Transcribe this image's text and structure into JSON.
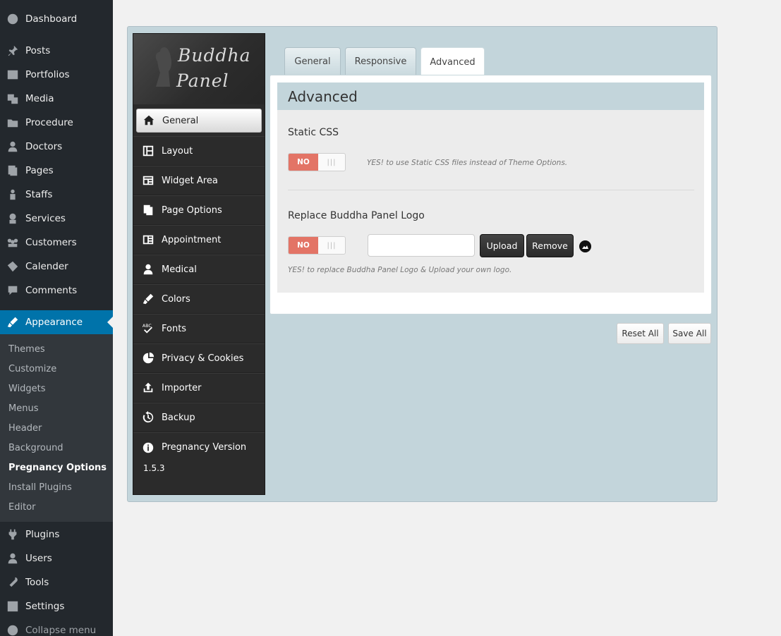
{
  "admin_menu": {
    "items": [
      {
        "label": "Dashboard",
        "icon": "dashboard-icon"
      },
      {
        "label": "Posts",
        "icon": "pin-icon"
      },
      {
        "label": "Portfolios",
        "icon": "portfolio-icon"
      },
      {
        "label": "Media",
        "icon": "media-icon"
      },
      {
        "label": "Procedure",
        "icon": "folder-icon"
      },
      {
        "label": "Doctors",
        "icon": "user-icon"
      },
      {
        "label": "Pages",
        "icon": "pages-icon"
      },
      {
        "label": "Staffs",
        "icon": "staff-icon"
      },
      {
        "label": "Services",
        "icon": "services-icon"
      },
      {
        "label": "Customers",
        "icon": "groups-icon"
      },
      {
        "label": "Calender",
        "icon": "tickets-icon"
      },
      {
        "label": "Comments",
        "icon": "comment-icon"
      },
      {
        "label": "Appearance",
        "icon": "brush-icon"
      },
      {
        "label": "Plugins",
        "icon": "plugin-icon"
      },
      {
        "label": "Users",
        "icon": "users-icon"
      },
      {
        "label": "Tools",
        "icon": "wrench-icon"
      },
      {
        "label": "Settings",
        "icon": "settings-icon"
      },
      {
        "label": "Collapse menu",
        "icon": "collapse-icon"
      }
    ],
    "submenu": [
      "Themes",
      "Customize",
      "Widgets",
      "Menus",
      "Header",
      "Background",
      "Pregnancy Options",
      "Install Plugins",
      "Editor"
    ]
  },
  "panel": {
    "logo_line1": "Buddha",
    "logo_line2": "Panel",
    "nav": [
      {
        "label": "General",
        "icon": "home-icon"
      },
      {
        "label": "Layout",
        "icon": "layout-icon"
      },
      {
        "label": "Widget Area",
        "icon": "widget-icon"
      },
      {
        "label": "Page Options",
        "icon": "page-options-icon"
      },
      {
        "label": "Appointment",
        "icon": "appointment-icon"
      },
      {
        "label": "Medical",
        "icon": "medical-icon"
      },
      {
        "label": "Colors",
        "icon": "brush-icon"
      },
      {
        "label": "Fonts",
        "icon": "fonts-icon"
      },
      {
        "label": "Privacy & Cookies",
        "icon": "pie-icon"
      },
      {
        "label": "Importer",
        "icon": "upload-icon"
      },
      {
        "label": "Backup",
        "icon": "backup-icon"
      },
      {
        "label": "Pregnancy Version",
        "icon": "info-icon"
      }
    ],
    "version": "1.5.3",
    "tabs": [
      "General",
      "Responsive",
      "Advanced"
    ],
    "section_title": "Advanced",
    "static_css": {
      "title": "Static CSS",
      "switch_label": "NO",
      "switch_grip": "|||",
      "hint": "YES! to use Static CSS files instead of Theme Options."
    },
    "replace_logo": {
      "title": "Replace Buddha Panel Logo",
      "switch_label": "NO",
      "switch_grip": "|||",
      "input_value": "",
      "upload_label": "Upload",
      "remove_label": "Remove",
      "hint": "YES! to replace Buddha Panel Logo & Upload your own logo."
    },
    "reset_label": "Reset All",
    "save_label": "Save All"
  },
  "colors": {
    "admin_bg": "#23282d",
    "admin_active": "#0073aa",
    "panel_bg": "#c3d5db",
    "switch_off": "#e37466"
  }
}
